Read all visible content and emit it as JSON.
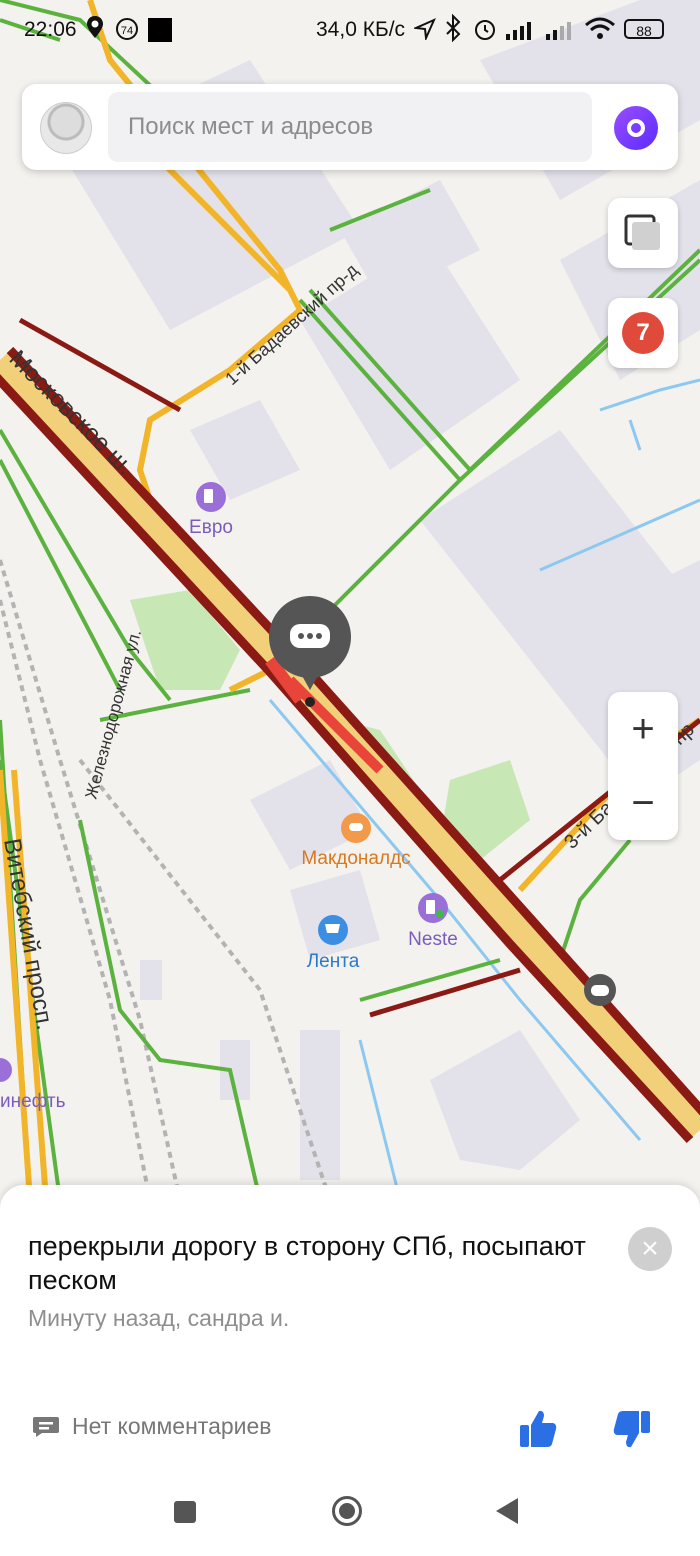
{
  "status_bar": {
    "time": "22:06",
    "notification_badge": "74",
    "network_speed": "34,0 КБ/с",
    "battery": "88"
  },
  "search": {
    "placeholder": "Поиск мест и адресов"
  },
  "map": {
    "traffic_badge": "7",
    "zoom_in_label": "+",
    "zoom_out_label": "−",
    "street_labels": {
      "moskovskoe": "Московское ш.",
      "badaevsky1": "1-й Бадаевский пр-д",
      "zheleznodorozhnaya": "Железнодорожная ул.",
      "vitebsky": "Витебский просп.",
      "badaevsky3": "3-й Бадаевский пр"
    },
    "poi": {
      "evro": "Евро",
      "mcdonalds": "Макдоналдс",
      "lenta": "Лента",
      "neste": "Neste",
      "neft": "инефть"
    }
  },
  "event_card": {
    "message": "перекрыли дорогу в сторону СПб, посыпают песком",
    "meta": "Минуту назад, сандра и.",
    "comments": "Нет комментариев",
    "close_label": "×"
  },
  "colors": {
    "heavy_traffic": "#8b1a14",
    "jam": "#e8443a",
    "moderate": "#f2b428",
    "free": "#5cb23e",
    "accent": "#2b6fe5",
    "alice": "#7b3cff"
  }
}
